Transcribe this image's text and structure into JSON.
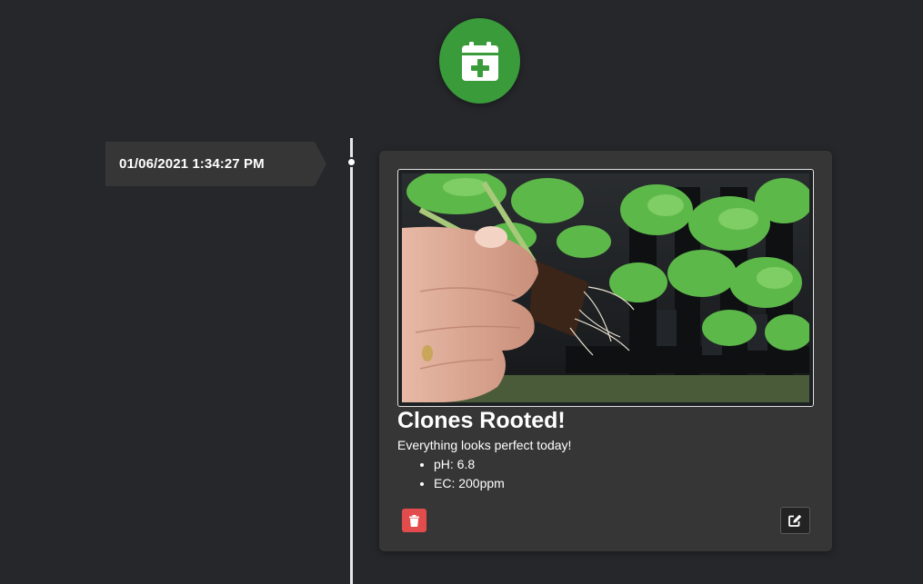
{
  "header": {
    "add_button_icon": "calendar-plus-icon",
    "add_button_color": "#3a9b3a"
  },
  "timeline": {
    "entries": [
      {
        "date": "01/06/2021 1:34:27 PM",
        "title": "Clones Rooted!",
        "note": "Everything looks perfect today!",
        "metrics": [
          "pH: 6.8",
          "EC: 200ppm"
        ],
        "photo": "rooted-clone-photo",
        "actions": {
          "delete_icon": "trash-icon",
          "delete_color": "#e34c4c",
          "edit_icon": "edit-icon"
        }
      }
    ]
  }
}
